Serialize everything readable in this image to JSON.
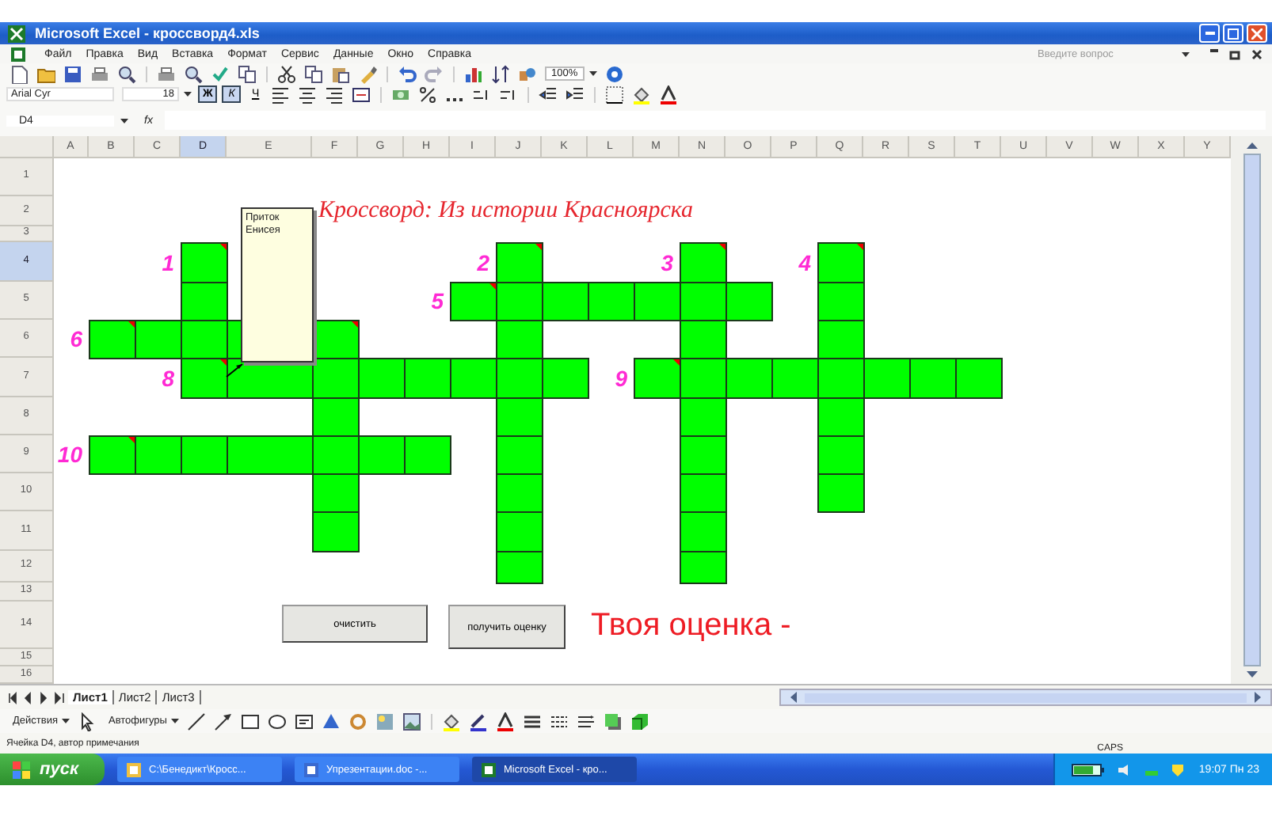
{
  "window": {
    "title": "Microsoft Excel - кроссворд4.xls"
  },
  "menu": [
    "Файл",
    "Правка",
    "Вид",
    "Вставка",
    "Формат",
    "Сервис",
    "Данные",
    "Окно",
    "Справка"
  ],
  "help_search": {
    "placeholder": "Введите вопрос"
  },
  "standard_toolbar": {
    "zoom": "100%"
  },
  "formatting_toolbar": {
    "font": "Arial Cyr",
    "size": "18",
    "styles": [
      {
        "label": "Ж",
        "pressed": true
      },
      {
        "label": "К",
        "pressed": true
      },
      {
        "label": "Ч",
        "pressed": false
      }
    ]
  },
  "formula_bar": {
    "name_box": "D4",
    "fx": "fx"
  },
  "sheet": {
    "columns": [
      {
        "label": "A",
        "selected": false
      },
      {
        "label": "B",
        "selected": false
      },
      {
        "label": "C",
        "selected": false
      },
      {
        "label": "D",
        "selected": true
      },
      {
        "label": "E",
        "selected": false
      },
      {
        "label": "F",
        "selected": false
      },
      {
        "label": "G",
        "selected": false
      },
      {
        "label": "H",
        "selected": false
      },
      {
        "label": "I",
        "selected": false
      },
      {
        "label": "J",
        "selected": false
      },
      {
        "label": "K",
        "selected": false
      },
      {
        "label": "L",
        "selected": false
      },
      {
        "label": "M",
        "selected": false
      },
      {
        "label": "N",
        "selected": false
      },
      {
        "label": "O",
        "selected": false
      },
      {
        "label": "P",
        "selected": false
      },
      {
        "label": "Q",
        "selected": false
      },
      {
        "label": "R",
        "selected": false
      },
      {
        "label": "S",
        "selected": false
      },
      {
        "label": "T",
        "selected": false
      },
      {
        "label": "U",
        "selected": false
      },
      {
        "label": "V",
        "selected": false
      },
      {
        "label": "W",
        "selected": false
      },
      {
        "label": "X",
        "selected": false
      },
      {
        "label": "Y",
        "selected": false
      }
    ],
    "rows": [
      {
        "header": "1",
        "selected": false
      },
      {
        "header": "2",
        "selected": false,
        "cells": [
          {
            "kind": "blank"
          },
          {
            "kind": "blank"
          },
          {
            "kind": "blank"
          },
          {
            "kind": "blank"
          },
          {
            "kind": "blank"
          },
          {
            "kind": "title",
            "text": "Кроссворд: Из истории Красноярска"
          }
        ]
      },
      {
        "header": "3",
        "selected": false
      },
      {
        "header": "4",
        "selected": true,
        "cells": [
          {
            "kind": "blank"
          },
          {
            "kind": "blank"
          },
          {
            "kind": "clue",
            "text": "1"
          },
          {
            "kind": "answer",
            "comment": true
          },
          {
            "kind": "blank"
          },
          {
            "kind": "blank"
          },
          {
            "kind": "blank"
          },
          {
            "kind": "blank"
          },
          {
            "kind": "clue",
            "text": "2"
          },
          {
            "kind": "answer",
            "comment": true
          },
          {
            "kind": "blank"
          },
          {
            "kind": "blank"
          },
          {
            "kind": "clue",
            "text": "3"
          },
          {
            "kind": "answer",
            "comment": true
          },
          {
            "kind": "blank"
          },
          {
            "kind": "clue",
            "text": "4"
          },
          {
            "kind": "answer",
            "comment": true
          }
        ]
      },
      {
        "header": "5",
        "selected": false,
        "cells": [
          {
            "kind": "blank"
          },
          {
            "kind": "blank"
          },
          {
            "kind": "blank"
          },
          {
            "kind": "answer",
            "comment": false
          },
          {
            "kind": "blank"
          },
          {
            "kind": "blank"
          },
          {
            "kind": "blank"
          },
          {
            "kind": "clue",
            "text": "5"
          },
          {
            "kind": "answer",
            "comment": true
          },
          {
            "kind": "answer",
            "comment": false
          },
          {
            "kind": "answer",
            "comment": false
          },
          {
            "kind": "answer",
            "comment": false
          },
          {
            "kind": "answer",
            "comment": false
          },
          {
            "kind": "answer",
            "comment": false
          },
          {
            "kind": "answer",
            "comment": false
          },
          {
            "kind": "blank"
          },
          {
            "kind": "answer",
            "comment": false
          }
        ]
      },
      {
        "header": "6",
        "selected": false,
        "cells": [
          {
            "kind": "clue",
            "text": "6"
          },
          {
            "kind": "answer",
            "comment": true
          },
          {
            "kind": "answer",
            "comment": false
          },
          {
            "kind": "answer",
            "comment": false
          },
          {
            "kind": "answer"
          },
          {
            "kind": "answer",
            "comment": true
          },
          {
            "kind": "blank"
          },
          {
            "kind": "blank"
          },
          {
            "kind": "blank"
          },
          {
            "kind": "answer",
            "comment": false
          },
          {
            "kind": "blank"
          },
          {
            "kind": "blank"
          },
          {
            "kind": "blank"
          },
          {
            "kind": "answer",
            "comment": false
          },
          {
            "kind": "blank"
          },
          {
            "kind": "blank"
          },
          {
            "kind": "answer",
            "comment": false
          }
        ]
      },
      {
        "header": "7",
        "selected": false,
        "cells": [
          {
            "kind": "blank"
          },
          {
            "kind": "blank"
          },
          {
            "kind": "clue",
            "text": "8"
          },
          {
            "kind": "answer",
            "comment": true
          },
          {
            "kind": "answer"
          },
          {
            "kind": "answer",
            "comment": false
          },
          {
            "kind": "answer",
            "comment": false
          },
          {
            "kind": "answer",
            "comment": false
          },
          {
            "kind": "answer",
            "comment": false
          },
          {
            "kind": "answer",
            "comment": false
          },
          {
            "kind": "answer",
            "comment": false
          },
          {
            "kind": "clue",
            "text": "9"
          },
          {
            "kind": "answer",
            "comment": true
          },
          {
            "kind": "answer",
            "comment": false
          },
          {
            "kind": "answer",
            "comment": false
          },
          {
            "kind": "answer",
            "comment": false
          },
          {
            "kind": "answer",
            "comment": false
          },
          {
            "kind": "answer",
            "comment": false
          },
          {
            "kind": "answer",
            "comment": false
          },
          {
            "kind": "answer",
            "comment": false
          }
        ]
      },
      {
        "header": "8",
        "selected": false,
        "cells": [
          {
            "kind": "blank"
          },
          {
            "kind": "blank"
          },
          {
            "kind": "blank"
          },
          {
            "kind": "blank"
          },
          {
            "kind": "blank"
          },
          {
            "kind": "answer",
            "comment": false
          },
          {
            "kind": "blank"
          },
          {
            "kind": "blank"
          },
          {
            "kind": "blank"
          },
          {
            "kind": "answer",
            "comment": false
          },
          {
            "kind": "blank"
          },
          {
            "kind": "blank"
          },
          {
            "kind": "blank"
          },
          {
            "kind": "answer",
            "comment": false
          },
          {
            "kind": "blank"
          },
          {
            "kind": "blank"
          },
          {
            "kind": "answer",
            "comment": false
          }
        ]
      },
      {
        "header": "9",
        "selected": false,
        "cells": [
          {
            "kind": "clue",
            "text": "10"
          },
          {
            "kind": "answer",
            "comment": true
          },
          {
            "kind": "answer",
            "comment": false
          },
          {
            "kind": "answer",
            "comment": false
          },
          {
            "kind": "answer",
            "comment": false
          },
          {
            "kind": "answer",
            "comment": false
          },
          {
            "kind": "answer",
            "comment": false
          },
          {
            "kind": "answer",
            "comment": false
          },
          {
            "kind": "blank"
          },
          {
            "kind": "answer",
            "comment": false
          },
          {
            "kind": "blank"
          },
          {
            "kind": "blank"
          },
          {
            "kind": "blank"
          },
          {
            "kind": "answer",
            "comment": false
          },
          {
            "kind": "blank"
          },
          {
            "kind": "blank"
          },
          {
            "kind": "answer",
            "comment": false
          }
        ]
      },
      {
        "header": "10",
        "selected": false,
        "cells": [
          {
            "kind": "blank"
          },
          {
            "kind": "blank"
          },
          {
            "kind": "blank"
          },
          {
            "kind": "blank"
          },
          {
            "kind": "blank"
          },
          {
            "kind": "answer",
            "comment": false
          },
          {
            "kind": "blank"
          },
          {
            "kind": "blank"
          },
          {
            "kind": "blank"
          },
          {
            "kind": "answer",
            "comment": false
          },
          {
            "kind": "blank"
          },
          {
            "kind": "blank"
          },
          {
            "kind": "blank"
          },
          {
            "kind": "answer",
            "comment": false
          },
          {
            "kind": "blank"
          },
          {
            "kind": "blank"
          },
          {
            "kind": "answer",
            "comment": false
          }
        ]
      },
      {
        "header": "11",
        "selected": false,
        "cells": [
          {
            "kind": "blank"
          },
          {
            "kind": "blank"
          },
          {
            "kind": "blank"
          },
          {
            "kind": "blank"
          },
          {
            "kind": "blank"
          },
          {
            "kind": "answer",
            "comment": false
          },
          {
            "kind": "blank"
          },
          {
            "kind": "blank"
          },
          {
            "kind": "blank"
          },
          {
            "kind": "answer",
            "comment": false
          },
          {
            "kind": "blank"
          },
          {
            "kind": "blank"
          },
          {
            "kind": "blank"
          },
          {
            "kind": "answer",
            "comment": false
          }
        ]
      },
      {
        "header": "12",
        "selected": false,
        "cells": [
          {
            "kind": "blank"
          },
          {
            "kind": "blank"
          },
          {
            "kind": "blank"
          },
          {
            "kind": "blank"
          },
          {
            "kind": "blank"
          },
          {
            "kind": "blank"
          },
          {
            "kind": "blank"
          },
          {
            "kind": "blank"
          },
          {
            "kind": "blank"
          },
          {
            "kind": "answer",
            "comment": false
          },
          {
            "kind": "blank"
          },
          {
            "kind": "blank"
          },
          {
            "kind": "blank"
          },
          {
            "kind": "answer",
            "comment": false
          }
        ]
      },
      {
        "header": "13",
        "selected": false
      },
      {
        "header": "14",
        "selected": false
      },
      {
        "header": "15",
        "selected": false
      },
      {
        "header": "16",
        "selected": false
      }
    ]
  },
  "comment": {
    "text": "Приток Енисея"
  },
  "buttons": [
    "очистить",
    "получить оценку"
  ],
  "score_label": "Твоя оценка -",
  "sheet_tabs": [
    {
      "label": "Лист1",
      "selected": true
    },
    {
      "label": "Лист2",
      "selected": false
    },
    {
      "label": "Лист3",
      "selected": false
    }
  ],
  "drawing_toolbar": {
    "actions": "Действия",
    "autoshapes": "Автофигуры"
  },
  "status_bar": {
    "text": "Ячейка D4, автор примечания",
    "caps": "CAPS"
  },
  "taskbar": {
    "start": "пуск",
    "tasks": [
      {
        "label": "C:\\Бенедикт\\Кросс...",
        "selected": false
      },
      {
        "label": "Упрезентации.doc -...",
        "selected": false
      },
      {
        "label": "Microsoft Excel - кро...",
        "selected": true
      }
    ],
    "clock": "19:07 Пн 23"
  }
}
